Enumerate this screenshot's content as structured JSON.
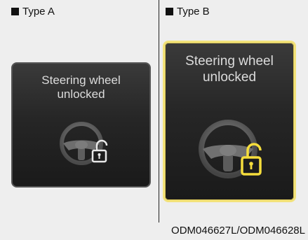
{
  "type_a": {
    "heading": "Type A",
    "message": "Steering wheel\nunlocked"
  },
  "type_b": {
    "heading": "Type B",
    "message": "Steering wheel\nunlocked"
  },
  "caption": "ODM046627L/ODM046628L",
  "icons": {
    "steering": "steering-wheel-icon",
    "lock": "unlocked-padlock-icon"
  },
  "colors": {
    "panel_b_border": "#f2e27a",
    "lock_b": "#f5dd3c",
    "lock_a": "#e8e8e8"
  }
}
